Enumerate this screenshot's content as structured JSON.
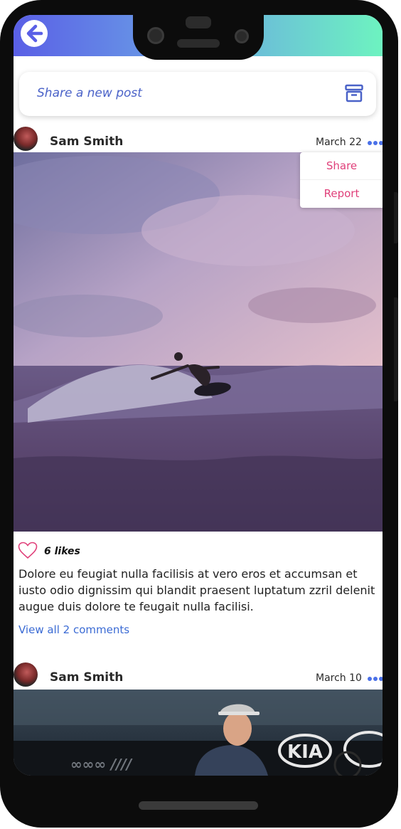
{
  "composer": {
    "placeholder": "Share a new post"
  },
  "posts": [
    {
      "user": "Sam Smith",
      "date": "March 22",
      "menu": [
        "Share",
        "Report"
      ],
      "likes": "6 likes",
      "caption": "Dolore eu feugiat nulla facilisis at vero eros et accumsan et iusto odio dignissim qui blandit praesent luptatum zzril delenit augue duis dolore te feugait nulla facilisi.",
      "comments_link": "View all 2 comments",
      "image": "surfer-at-sunset"
    },
    {
      "user": "Sam Smith",
      "date": "March 10",
      "image": "tennis-player-stadium",
      "banner_text": "KIA"
    }
  ],
  "icons": [
    "back-arrow-icon",
    "archive-box-icon",
    "more-dots-icon",
    "heart-icon"
  ],
  "colors": {
    "header_start": "#5a5fe6",
    "header_end": "#6df3c0",
    "accent": "#4a62c8",
    "menu_text": "#e0407a",
    "link": "#3b6bd4"
  }
}
